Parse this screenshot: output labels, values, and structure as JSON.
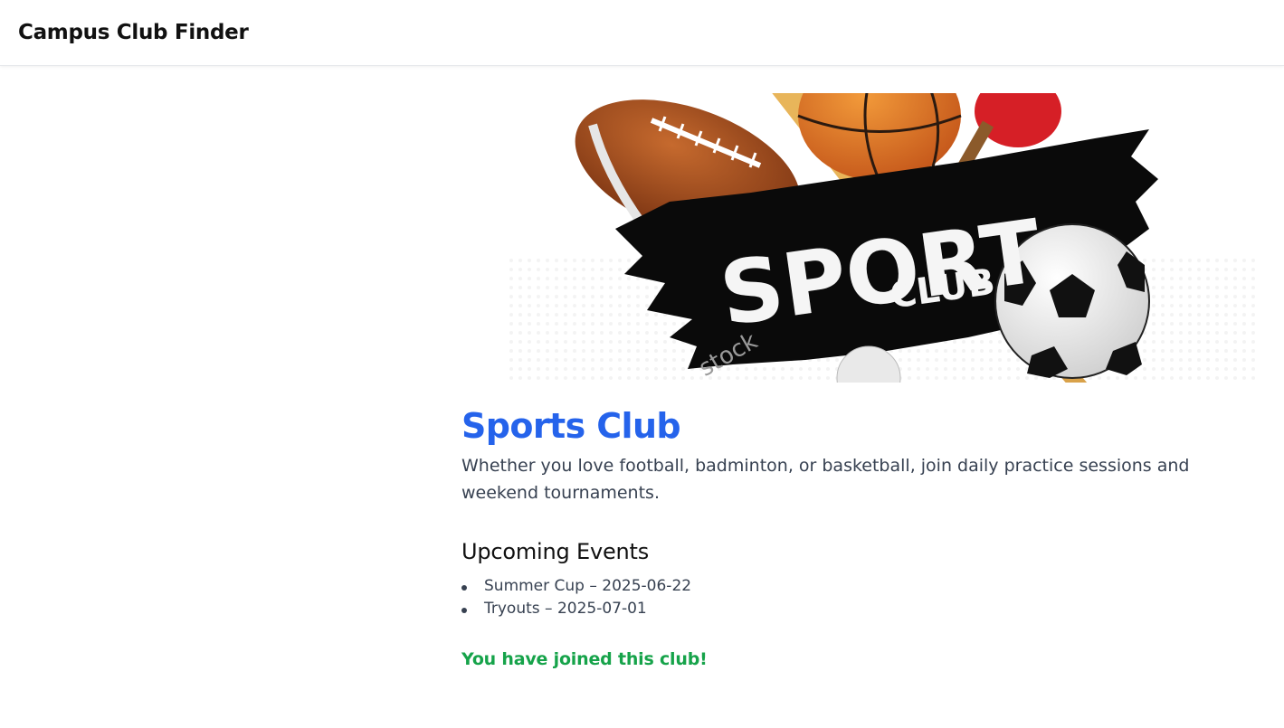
{
  "header": {
    "app_title": "Campus Club Finder"
  },
  "club": {
    "banner": {
      "headline": "SPORT",
      "subline": "CLUB",
      "watermark": "stock",
      "icons": [
        "american-football-icon",
        "basketball-icon",
        "cricket-bat-icon",
        "ping-pong-paddle-icon",
        "soccer-ball-icon",
        "golf-ball-icon"
      ]
    },
    "title": "Sports Club",
    "description": "Whether you love football, badminton, or basketball, join daily practice sessions and weekend tournaments.",
    "events_heading": "Upcoming Events",
    "events": [
      {
        "label": "Summer Cup – 2025-06-22"
      },
      {
        "label": "Tryouts – 2025-07-01"
      }
    ],
    "status_message": "You have joined this club!"
  },
  "colors": {
    "title_blue": "#2563eb",
    "status_green": "#16a34a",
    "body_text": "#374151"
  }
}
